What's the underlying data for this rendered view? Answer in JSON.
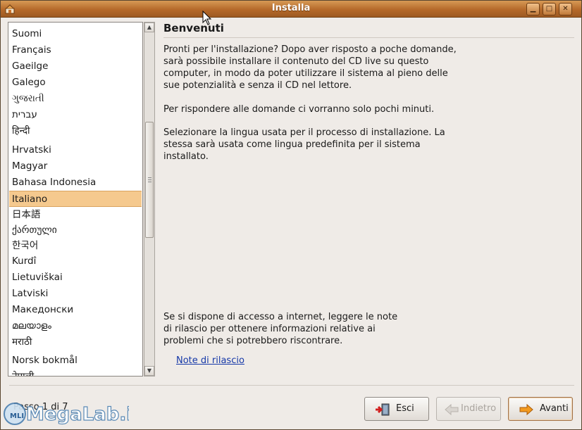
{
  "window": {
    "title": "Installa"
  },
  "languages": [
    "Suomi",
    "Français",
    "Gaeilge",
    "Galego",
    "ગુજરાતી",
    "עברית",
    "हिन्दी",
    "Hrvatski",
    "Magyar",
    "Bahasa Indonesia",
    "Italiano",
    "日本語",
    "ქართული",
    "한국어",
    "Kurdî",
    "Lietuviškai",
    "Latviski",
    "Македонски",
    "മലയാളം",
    "मराठी",
    "Norsk bokmål",
    "नेपाली"
  ],
  "selected_language": "Italiano",
  "content": {
    "heading": "Benvenuti",
    "para1": "Pronti per l'installazione? Dopo aver risposto a poche domande, sarà possibile installare il contenuto del CD live su questo computer, in modo da poter utilizzare il sistema al pieno delle sue potenzialità e senza il CD nel lettore.",
    "para2": "Per rispondere alle domande ci vorranno solo pochi minuti.",
    "para3": "Selezionare la lingua usata per il processo di installazione. La stessa sarà usata come lingua predefinita per il sistema installato.",
    "para4": "Se si dispone di accesso a internet, leggere le note di rilascio per ottenere informazioni relative ai problemi che si potrebbero riscontrare.",
    "release_notes_link": "Note di rilascio"
  },
  "footer": {
    "step_text": "Passo 1 di 7",
    "quit_label": "Esci",
    "back_label": "Indietro",
    "forward_label": "Avanti"
  },
  "watermark": "MegaLab.it",
  "colors": {
    "titlebar": "#b5692a",
    "selection": "#f5c98e",
    "link": "#1538a8",
    "window_bg": "#efebe7"
  },
  "icons": {
    "app": "installer-icon",
    "minimize": "minimize-icon",
    "maximize": "maximize-icon",
    "close": "close-icon",
    "quit": "exit-door-icon",
    "back": "arrow-left-icon",
    "forward": "arrow-right-icon"
  }
}
